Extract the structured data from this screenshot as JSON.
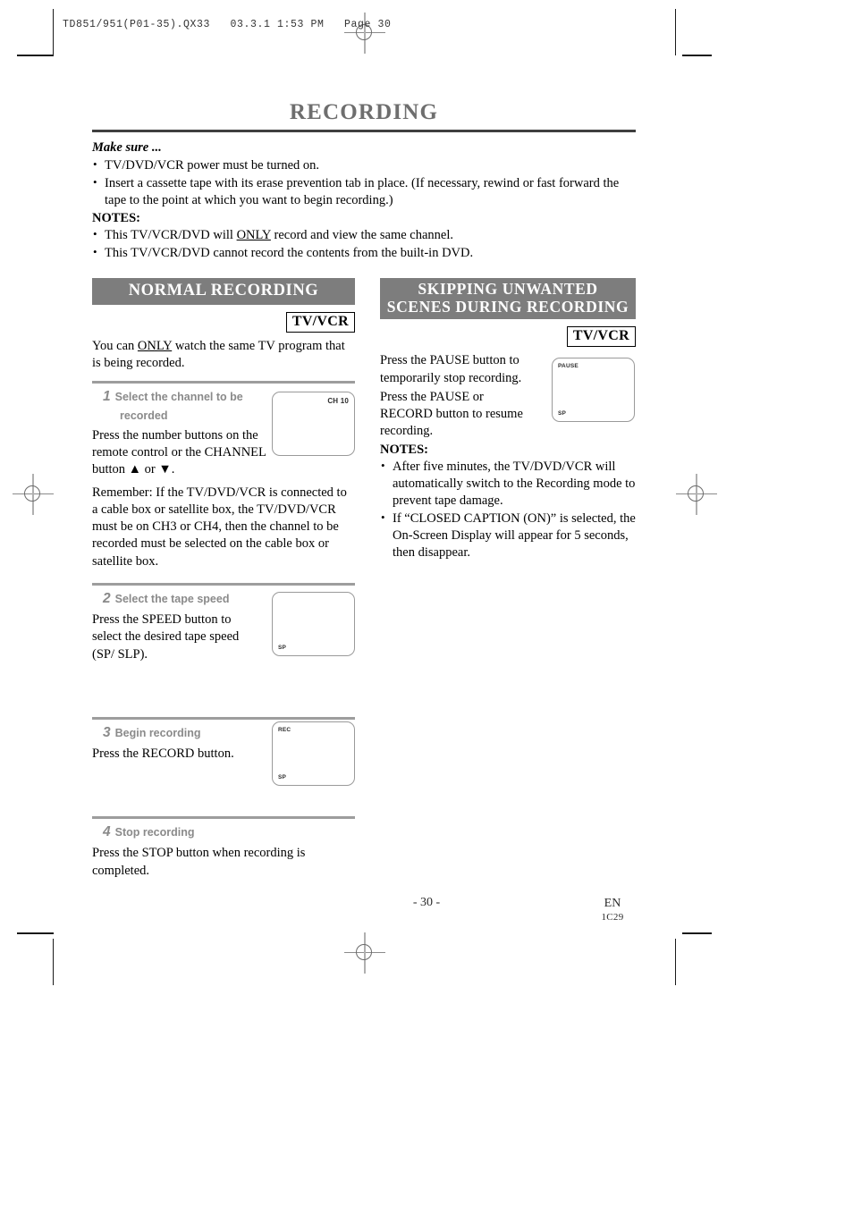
{
  "print_slug": "TD851/951(P01-35).QX33   03.3.1 1:53 PM   Page 30",
  "page_title": "RECORDING",
  "intro": {
    "make_sure_label": "Make sure ...",
    "make_sure_items": [
      "TV/DVD/VCR power must be turned on.",
      "Insert a cassette tape with its erase prevention tab in place. (If necessary, rewind or fast forward the tape to the point at which you want to begin recording.)"
    ],
    "notes_label": "NOTES:",
    "notes_items_pre": [
      "This TV/VCR/DVD will ",
      "This TV/VCR/DVD cannot record the contents from the built-in DVD."
    ],
    "note1_underlined": "ONLY",
    "note1_post": " record and view the same channel."
  },
  "left_column": {
    "section_title": "NORMAL RECORDING",
    "badge": "TV/VCR",
    "intro_pre": "You can ",
    "intro_underlined": "ONLY",
    "intro_post": " watch the same TV program that is being recorded.",
    "steps": [
      {
        "num": "1",
        "head_line1": "Select the channel to be",
        "head_line2": "recorded",
        "body1": "Press the number buttons on the remote control or the CHANNEL button ▲ or ▼.",
        "body2": "Remember: If the TV/DVD/VCR is connected to a cable box or satellite box, the TV/DVD/VCR must be on CH3 or CH4, then the channel to be recorded must be selected on the cable box or satellite box.",
        "screen_osd_top_right": "CH 10"
      },
      {
        "num": "2",
        "head_line1": "Select the tape speed",
        "body1": "Press the SPEED button to select the desired tape speed (SP/ SLP).",
        "screen_osd_bottom_left": "SP"
      },
      {
        "num": "3",
        "head_line1": "Begin recording",
        "body1": "Press the RECORD button.",
        "screen_osd_top_left": "REC",
        "screen_osd_bottom_left": "SP"
      },
      {
        "num": "4",
        "head_line1": "Stop recording",
        "body1": "Press the STOP button when recording is completed."
      }
    ]
  },
  "right_column": {
    "section_title_line1": "SKIPPING UNWANTED",
    "section_title_line2": "SCENES DURING RECORDING",
    "badge": "TV/VCR",
    "body1": "Press the PAUSE button to temporarily stop recording.",
    "body2": "Press the PAUSE or RECORD button to resume recording.",
    "notes_label": "NOTES:",
    "notes_items": [
      "After five minutes, the TV/DVD/VCR will automatically switch to the Recording mode to prevent tape damage.",
      "If “CLOSED CAPTION (ON)” is selected, the On-Screen Display will appear for 5 seconds, then disappear."
    ],
    "screen_osd_top_left": "PAUSE",
    "screen_osd_bottom_left": "SP"
  },
  "footer": {
    "page_number": "- 30 -",
    "language": "EN",
    "doc_code": "1C29"
  },
  "colors": {
    "section_bar": "#7d7d7d",
    "title_text": "#6e6e6e",
    "title_rule": "#3f3f3f",
    "step_rule": "#9d9d9d",
    "step_head_text": "#8a8a8a",
    "screen_border": "#9a9a9a"
  }
}
